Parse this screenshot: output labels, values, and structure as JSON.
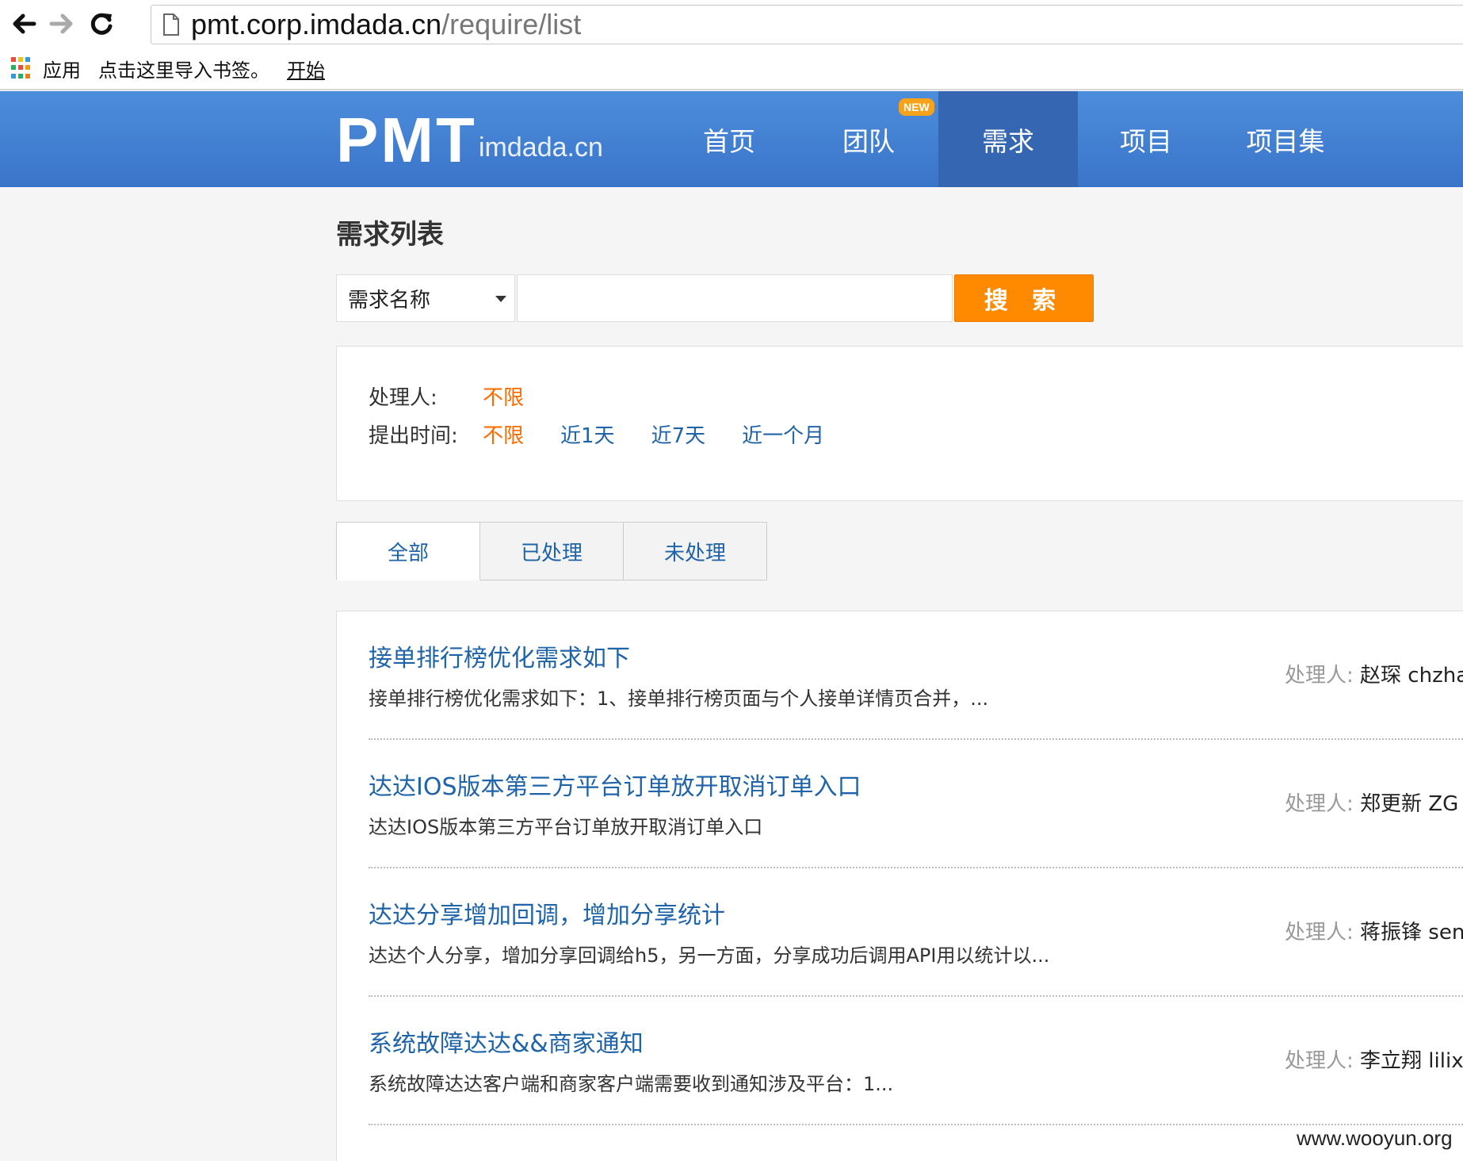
{
  "browser": {
    "url_host": "pmt.corp.imdada.cn",
    "url_path": "/require/list",
    "bookmarks": [
      "应用",
      "点击这里导入书签。"
    ],
    "bookmark_link": "开始"
  },
  "header": {
    "logo": "PMT",
    "logo_sub": "imdada.cn",
    "badge": "NEW",
    "nav": [
      "首页",
      "团队",
      "需求",
      "项目",
      "项目集"
    ],
    "active_nav": "需求"
  },
  "page": {
    "title": "需求列表"
  },
  "search": {
    "select_value": "需求名称",
    "input_value": "",
    "button_label": "搜 索"
  },
  "filters": {
    "handler_label": "处理人:",
    "handler_options": [
      "不限"
    ],
    "time_label": "提出时间:",
    "time_options": [
      "不限",
      "近1天",
      "近7天",
      "近一个月"
    ]
  },
  "tabs": [
    "全部",
    "已处理",
    "未处理"
  ],
  "requirements": [
    {
      "title": "接单排行榜优化需求如下",
      "desc": "接单排行榜优化需求如下：1、接单排行榜页面与个人接单详情页合并，...",
      "handler_label": "处理人:",
      "handler": "赵琛 chzha"
    },
    {
      "title": "达达IOS版本第三方平台订单放开取消订单入口",
      "desc": "达达IOS版本第三方平台订单放开取消订单入口",
      "handler_label": "处理人:",
      "handler": "郑更新 ZG"
    },
    {
      "title": "达达分享增加回调，增加分享统计",
      "desc": "达达个人分享，增加分享回调给h5，另一方面，分享成功后调用API用以统计以...",
      "handler_label": "处理人:",
      "handler": "蒋振锋 sen"
    },
    {
      "title": "系统故障达达&&商家通知",
      "desc": "系统故障达达客户端和商家客户端需要收到通知涉及平台：1...",
      "handler_label": "处理人:",
      "handler": "李立翔 lilix"
    }
  ],
  "watermark": "www.wooyun.org",
  "colors": {
    "header_blue": "#3a74c8",
    "active_nav": "#3566b2",
    "link_blue": "#1f63a8",
    "accent_orange": "#ff8a00",
    "selected_orange": "#ff6a00",
    "badge_orange": "#f7a21b"
  }
}
